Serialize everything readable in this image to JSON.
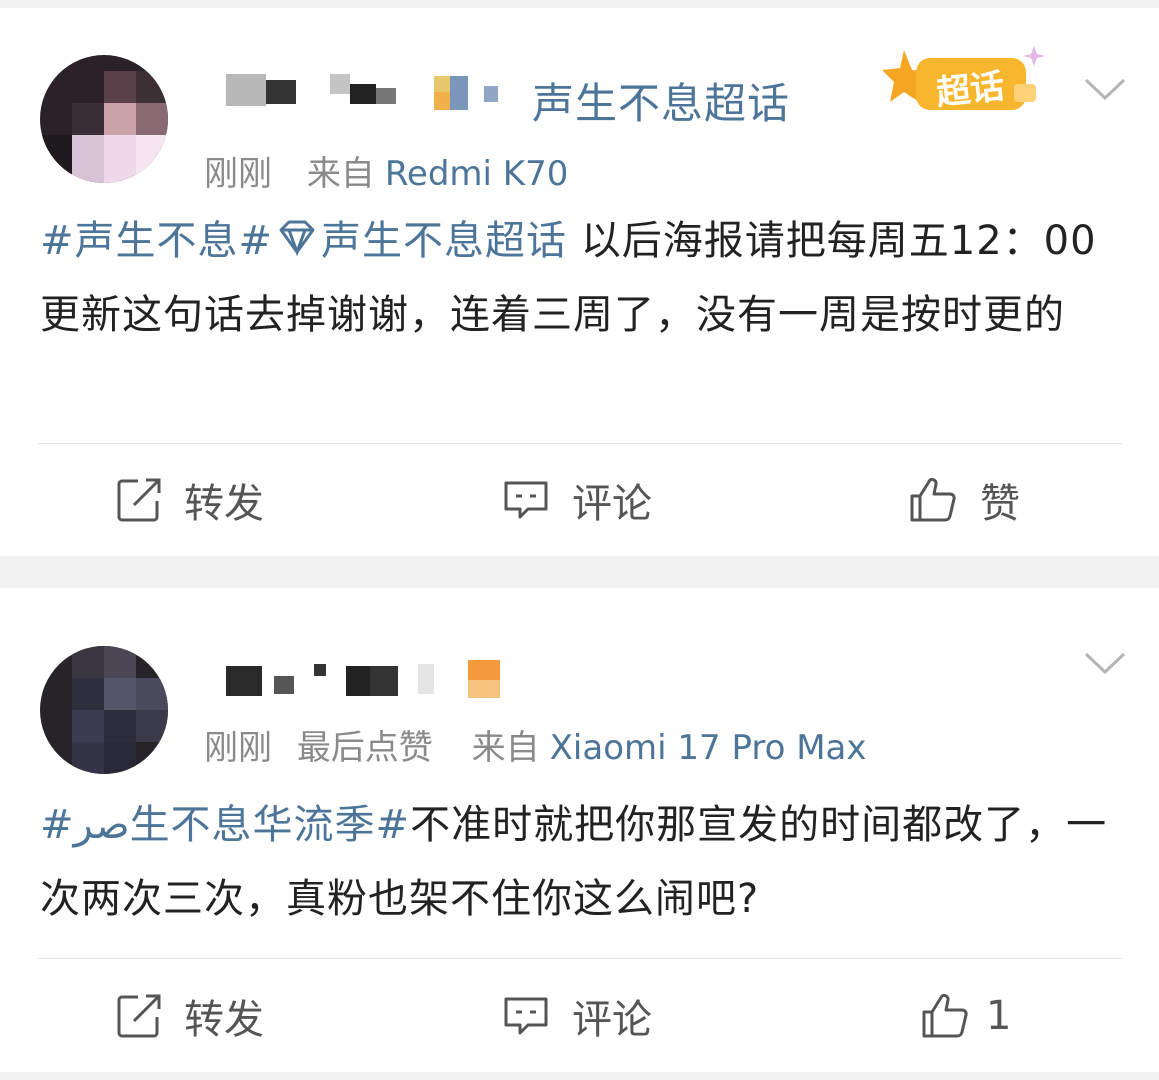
{
  "posts": [
    {
      "topic_label": "声生不息超话",
      "badge_text": "超话",
      "meta": {
        "time": "刚刚",
        "source_prefix": "来自",
        "device": "Redmi K70"
      },
      "content": {
        "tag1": "#声生不息#",
        "tag2": "声生不息超话",
        "text": " 以后海报请把每周五12：00更新这句话去掉谢谢，连着三周了，没有一周是按时更的"
      },
      "actions": {
        "repost": "转发",
        "comment": "评论",
        "like": "赞"
      }
    },
    {
      "meta": {
        "time": "刚刚",
        "extra": "最后点赞",
        "source_prefix": "来自",
        "device": "Xiaomi 17 Pro Max"
      },
      "content": {
        "tag1": "#ﺻﺮ生不息华流季#",
        "text": "不准时就把你那宣发的时间都改了，一次两次三次，真粉也架不住你这么闹吧?"
      },
      "actions": {
        "repost": "转发",
        "comment": "评论",
        "like": "1"
      }
    }
  ],
  "colors": {
    "link": "#4d7599",
    "meta": "#8a8a8a",
    "text": "#222222",
    "badge": "#f5a623"
  },
  "icons": [
    "chevron-down-icon",
    "repost-icon",
    "comment-icon",
    "like-icon",
    "diamond-icon"
  ]
}
